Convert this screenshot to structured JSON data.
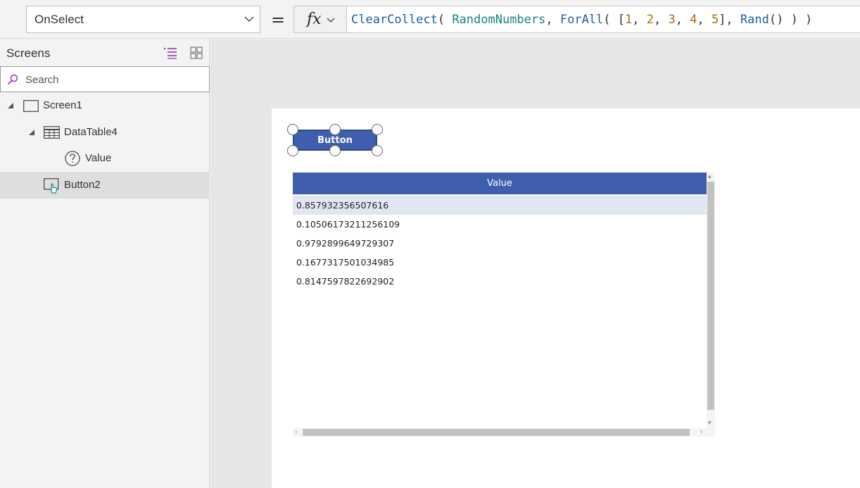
{
  "formula_bar": {
    "property": "OnSelect",
    "equals": "=",
    "fx_label": "fx",
    "formula_tokens": [
      {
        "t": "ClearCollect",
        "k": "fn"
      },
      {
        "t": "( ",
        "k": "p"
      },
      {
        "t": "RandomNumbers",
        "k": "id"
      },
      {
        "t": ", ",
        "k": "p"
      },
      {
        "t": "ForAll",
        "k": "fn"
      },
      {
        "t": "( [",
        "k": "p"
      },
      {
        "t": "1",
        "k": "num"
      },
      {
        "t": ", ",
        "k": "p"
      },
      {
        "t": "2",
        "k": "num"
      },
      {
        "t": ", ",
        "k": "p"
      },
      {
        "t": "3",
        "k": "num"
      },
      {
        "t": ", ",
        "k": "p"
      },
      {
        "t": "4",
        "k": "num"
      },
      {
        "t": ", ",
        "k": "p"
      },
      {
        "t": "5",
        "k": "num"
      },
      {
        "t": "], ",
        "k": "p"
      },
      {
        "t": "Rand",
        "k": "fn"
      },
      {
        "t": "() ) )",
        "k": "p"
      }
    ]
  },
  "left_pane": {
    "title": "Screens",
    "search_placeholder": "Search",
    "tree": [
      {
        "label": "Screen1",
        "icon": "screen-icon"
      },
      {
        "label": "DataTable4",
        "icon": "datatable-icon"
      },
      {
        "label": "Value",
        "icon": "question-icon"
      },
      {
        "label": "Button2",
        "icon": "button-icon"
      }
    ]
  },
  "canvas": {
    "button_label": "Button",
    "table": {
      "column": "Value",
      "rows": [
        "0.857932356507616",
        "0.10506173211256109",
        "0.9792899649729307",
        "0.1677317501034985",
        "0.8147597822692902"
      ]
    }
  },
  "colors": {
    "accent": "#3f5fae",
    "selected_row": "#e1e6f2",
    "function_token": "#1a5ea7",
    "identifier_token": "#16847a",
    "number_token": "#b06d00"
  }
}
